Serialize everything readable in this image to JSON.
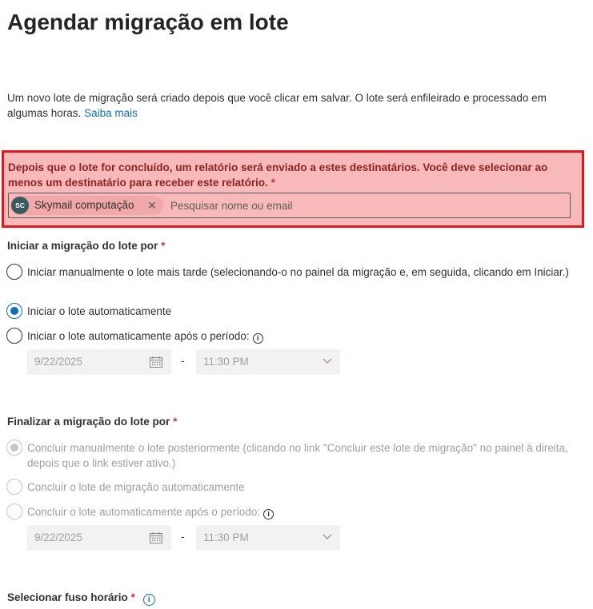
{
  "page": {
    "title": "Agendar migração em lote",
    "intro_text": "Um novo lote de migração será criado depois que você clicar em salvar. O lote será enfileirado e processado em algumas horas. ",
    "intro_link": "Saiba mais"
  },
  "recipients": {
    "label": "Depois que o lote for concluído, um relatório será enviado a estes destinatários. Você deve selecionar ao menos um destinatário para receber este relatório.",
    "required_mark": "*",
    "chip": {
      "initials": "SC",
      "name": "Skymail computação",
      "remove": "✕"
    },
    "search_placeholder": "Pesquisar nome ou email",
    "search_value": ""
  },
  "start": {
    "label": "Iniciar a migração do lote por",
    "required_mark": "*",
    "options": [
      {
        "label": "Iniciar manualmente o lote mais tarde (selecionando-o no painel da migração e, em seguida, clicando em Iniciar.)",
        "checked": false
      },
      {
        "label": "Iniciar o lote automaticamente",
        "checked": true
      },
      {
        "label": "Iniciar o lote automaticamente após o período:",
        "checked": false
      }
    ],
    "date": "9/22/2025",
    "separator": "-",
    "time": "11:30 PM"
  },
  "finish": {
    "label": "Finalizar a migração do lote por",
    "required_mark": "*",
    "options": [
      {
        "label": "Concluir manualmente o lote posteriormente (clicando no link \"Concluir este lote de migração\" no painel à direita, depois que o link estiver ativo.)",
        "checked": true,
        "disabled": true
      },
      {
        "label": "Concluir o lote de migração automaticamente",
        "checked": false,
        "disabled": true
      },
      {
        "label": "Concluir o lote automaticamente após o período:",
        "checked": false,
        "disabled": true
      }
    ],
    "date": "9/22/2025",
    "separator": "-",
    "time": "11:30 PM"
  },
  "timezone": {
    "label": "Selecionar fuso horário",
    "required_mark": "*"
  },
  "info_glyph": "i",
  "colors": {
    "accent": "#0f6cbd",
    "error_border": "#e0171c",
    "error_background": "#f7b9b9",
    "error_text": "#8f2222",
    "required": "#c4314b"
  }
}
